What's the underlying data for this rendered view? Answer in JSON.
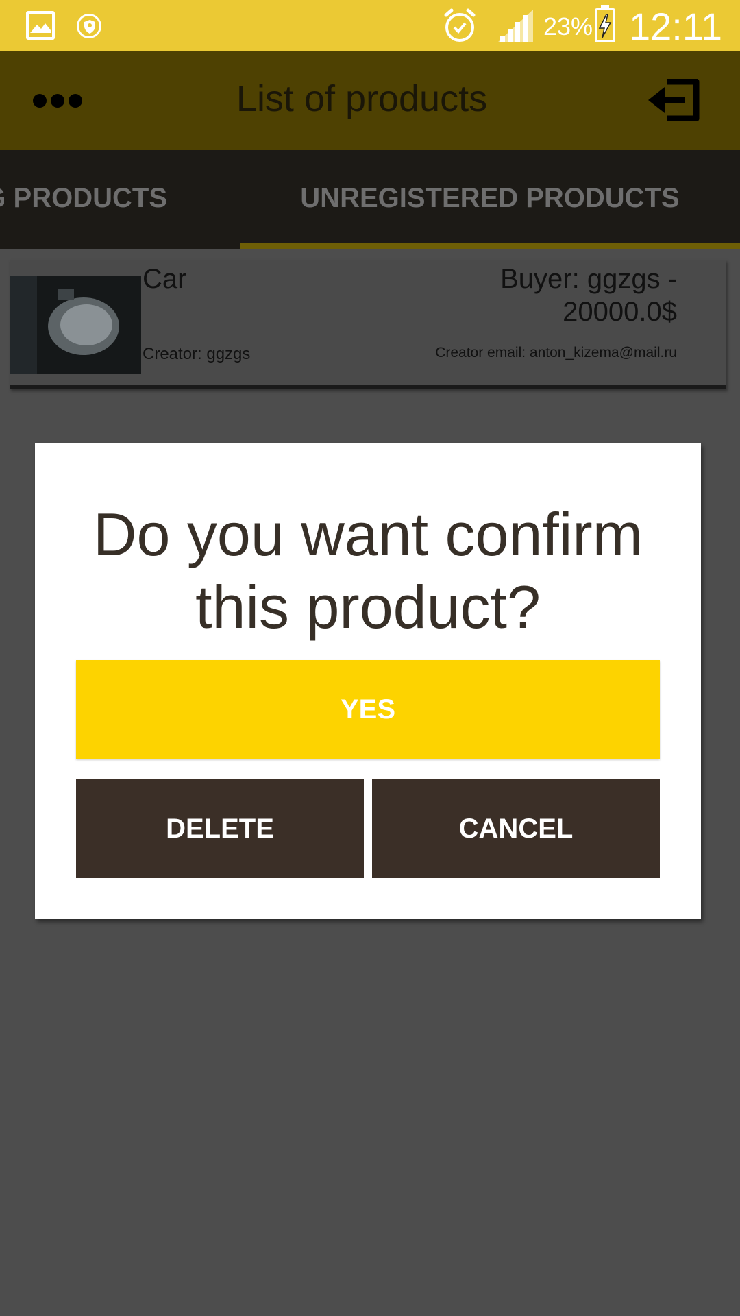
{
  "status_bar": {
    "battery_percent": "23%",
    "time": "12:11",
    "icons": [
      "gallery-icon",
      "shield-icon",
      "alarm-icon",
      "signal-icon",
      "battery-charging-icon"
    ]
  },
  "app_bar": {
    "title": "List of products",
    "menu_icon": "more-dots-icon",
    "logout_icon": "logout-icon"
  },
  "tabs": [
    {
      "label": "G PRODUCTS",
      "selected": false
    },
    {
      "label": "UNREGISTERED PRODUCTS",
      "selected": true
    }
  ],
  "product": {
    "name": "Car",
    "creator": "Creator: ggzgs",
    "buyer_line1": "Buyer: ggzgs -",
    "buyer_line2": "20000.0$",
    "creator_email": "Creator email: anton_kizema@mail.ru"
  },
  "dialog": {
    "title_line1": "Do you want confirm",
    "title_line2": "this product?",
    "yes_label": "YES",
    "delete_label": "DELETE",
    "cancel_label": "CANCEL"
  },
  "colors": {
    "status_bar": "#ebc934",
    "app_bar_dimmed": "#4e4102",
    "tabs_bg": "#1c1a16",
    "overlay_bg": "#4d4d4d",
    "accent_yellow": "#fdd300",
    "dark_button": "#3b2f27",
    "dialog_text": "#372f27"
  }
}
